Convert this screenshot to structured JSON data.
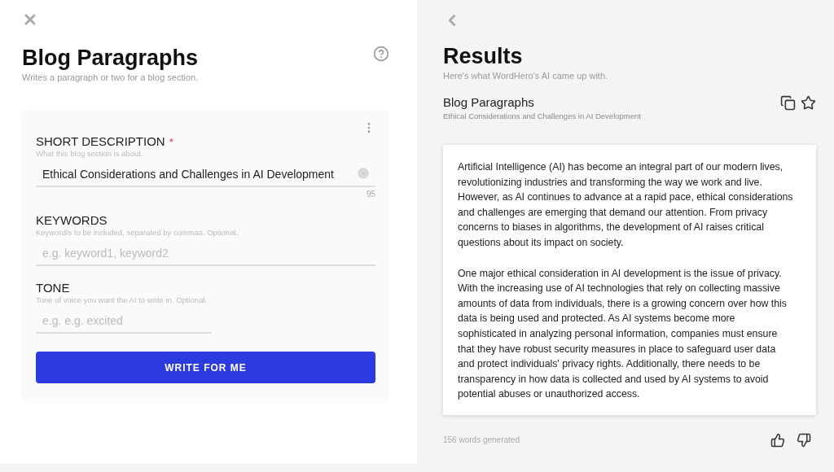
{
  "form": {
    "title": "Blog Paragraphs",
    "subtitle": "Writes a paragraph or two for a blog section.",
    "fields": [
      {
        "label": "SHORT DESCRIPTION",
        "required": true,
        "hint": "What this blog section is about.",
        "value": "Ethical Considerations and Challenges in AI Development",
        "counter": "95",
        "short": false
      },
      {
        "label": "KEYWORDS",
        "required": false,
        "hint": "Keyword/s to be included, separated by commas. Optional.",
        "placeholder": "e.g. keyword1, keyword2",
        "short": false
      },
      {
        "label": "TONE",
        "required": false,
        "hint": "Tone of voice you want the AI to write in. Optional.",
        "placeholder": "e.g. e.g. excited",
        "short": true
      }
    ],
    "required_mark": "*",
    "button": "WRITE FOR ME"
  },
  "results": {
    "title": "Results",
    "subtitle": "Here's what WordHero's AI came up with.",
    "item_title": "Blog Paragraphs",
    "item_subtitle": "Ethical Considerations and Challenges in AI Development",
    "paragraphs": [
      "Artificial Intelligence (AI) has become an integral part of our modern lives, revolutionizing industries and transforming the way we work and live. However, as AI continues to advance at a rapid pace, ethical considerations and challenges are emerging that demand our attention. From privacy concerns to biases in algorithms, the development of AI raises critical questions about its impact on society.",
      "One major ethical consideration in AI development is the issue of privacy. With the increasing use of AI technologies that rely on collecting massive amounts of data from individuals, there is a growing concern over how this data is being used and protected. As AI systems become more sophisticated in analyzing personal information, companies must ensure that they have robust security measures in place to safeguard user data and protect individuals' privacy rights. Additionally, there needs to be transparency in how data is collected and used by AI systems to avoid potential abuses or unauthorized access."
    ],
    "word_count": "156 words generated"
  }
}
